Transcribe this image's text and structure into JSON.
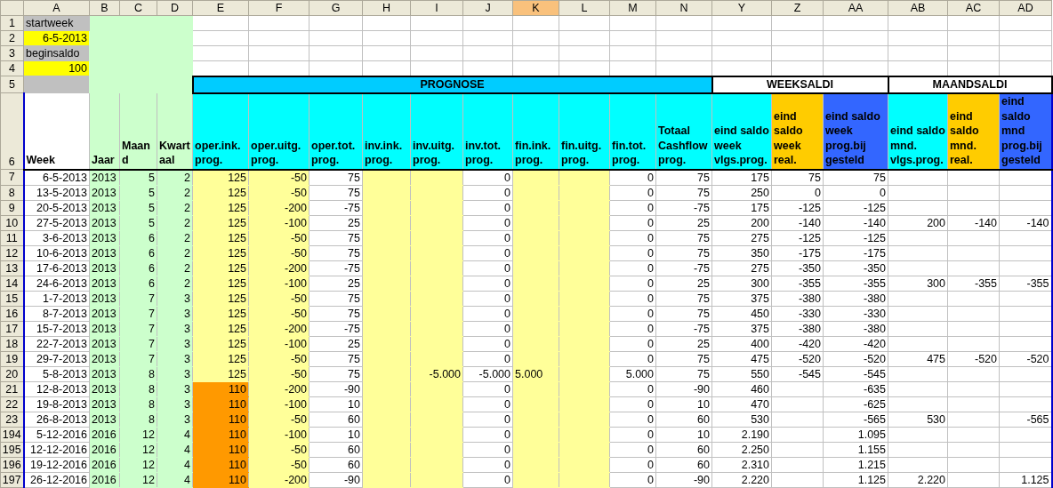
{
  "columns": [
    {
      "letter": "A",
      "selected": false,
      "color": "#ffffff"
    },
    {
      "letter": "B",
      "selected": false,
      "color": "#ccffcc"
    },
    {
      "letter": "C",
      "selected": false,
      "color": "#ccffcc"
    },
    {
      "letter": "D",
      "selected": false,
      "color": "#ccffcc"
    },
    {
      "letter": "E",
      "selected": false,
      "color": "#ffff99"
    },
    {
      "letter": "F",
      "selected": false,
      "color": "#ffff99"
    },
    {
      "letter": "G",
      "selected": false,
      "color": "#ffffff"
    },
    {
      "letter": "H",
      "selected": false,
      "color": "#ffff99"
    },
    {
      "letter": "I",
      "selected": false,
      "color": "#ffff99"
    },
    {
      "letter": "J",
      "selected": false,
      "color": "#ffffff"
    },
    {
      "letter": "K",
      "selected": true,
      "color": "#ffff99"
    },
    {
      "letter": "L",
      "selected": false,
      "color": "#ffff99"
    },
    {
      "letter": "M",
      "selected": false,
      "color": "#ffffff"
    },
    {
      "letter": "N",
      "selected": false,
      "color": "#ffffff"
    },
    {
      "letter": "Y",
      "selected": false,
      "color": "#ffffff"
    },
    {
      "letter": "Z",
      "selected": false,
      "color": "#ffffff"
    },
    {
      "letter": "AA",
      "selected": false,
      "color": "#ffffff"
    },
    {
      "letter": "AB",
      "selected": false,
      "color": "#ffffff"
    },
    {
      "letter": "AC",
      "selected": false,
      "color": "#ffffff"
    },
    {
      "letter": "AD",
      "selected": false,
      "color": "#ffffff"
    }
  ],
  "settings": [
    {
      "row": "1",
      "kind": "label",
      "text": "startweek"
    },
    {
      "row": "2",
      "kind": "value",
      "text": "6-5-2013"
    },
    {
      "row": "3",
      "kind": "label",
      "text": "beginsaldo"
    },
    {
      "row": "4",
      "kind": "value",
      "text": "100"
    }
  ],
  "section_row": "5",
  "sections": [
    {
      "title": "PROGNOSE",
      "color": "#00ccff"
    },
    {
      "title": "WEEKSALDI",
      "color": "#ffffff"
    },
    {
      "title": "MAANDSALDI",
      "color": "#ffffff"
    }
  ],
  "heading_row": "6",
  "headings": [
    {
      "text": "Week",
      "color": "#ffffff"
    },
    {
      "text": "Jaar",
      "color": "#ccffcc"
    },
    {
      "text": "Maand",
      "color": "#ccffcc"
    },
    {
      "text": "Kwartaal",
      "color": "#ccffcc"
    },
    {
      "text": "oper.ink. prog.",
      "color": "#00ffff"
    },
    {
      "text": "oper.uitg. prog.",
      "color": "#00ffff"
    },
    {
      "text": "oper.tot. prog.",
      "color": "#00ffff"
    },
    {
      "text": "inv.ink. prog.",
      "color": "#00ffff"
    },
    {
      "text": "inv.uitg. prog.",
      "color": "#00ffff"
    },
    {
      "text": "inv.tot. prog.",
      "color": "#00ffff"
    },
    {
      "text": "fin.ink. prog.",
      "color": "#00ffff"
    },
    {
      "text": "fin.uitg. prog.",
      "color": "#00ffff"
    },
    {
      "text": "fin.tot. prog.",
      "color": "#00ffff"
    },
    {
      "text": "Totaal Cashflow prog.",
      "color": "#00ffff"
    },
    {
      "text": "eind saldo week vlgs.prog.",
      "color": "#00ffff"
    },
    {
      "text": "eind saldo week real.",
      "color": "#ffcc00"
    },
    {
      "text": "eind saldo week prog.bij gesteld",
      "color": "#3366ff"
    },
    {
      "text": "eind saldo mnd. vlgs.prog.",
      "color": "#00ffff"
    },
    {
      "text": "eind saldo mnd. real.",
      "color": "#ffcc00"
    },
    {
      "text": "eind saldo mnd prog.bij gesteld",
      "color": "#3366ff"
    }
  ],
  "rows": [
    {
      "row": "7",
      "cells": [
        "6-5-2013",
        "2013",
        "5",
        "2",
        "125",
        "-50",
        "75",
        null,
        null,
        "0",
        null,
        null,
        "0",
        "75",
        "175",
        "75",
        "75",
        null,
        null,
        null
      ]
    },
    {
      "row": "8",
      "cells": [
        "13-5-2013",
        "2013",
        "5",
        "2",
        "125",
        "-50",
        "75",
        null,
        null,
        "0",
        null,
        null,
        "0",
        "75",
        "250",
        "0",
        "0",
        null,
        null,
        null
      ]
    },
    {
      "row": "9",
      "cells": [
        "20-5-2013",
        "2013",
        "5",
        "2",
        "125",
        "-200",
        "-75",
        null,
        null,
        "0",
        null,
        null,
        "0",
        "-75",
        "175",
        "-125",
        "-125",
        null,
        null,
        null
      ]
    },
    {
      "row": "10",
      "cells": [
        "27-5-2013",
        "2013",
        "5",
        "2",
        "125",
        "-100",
        "25",
        null,
        null,
        "0",
        null,
        null,
        "0",
        "25",
        "200",
        "-140",
        "-140",
        "200",
        "-140",
        "-140"
      ]
    },
    {
      "row": "11",
      "cells": [
        "3-6-2013",
        "2013",
        "6",
        "2",
        "125",
        "-50",
        "75",
        null,
        null,
        "0",
        null,
        null,
        "0",
        "75",
        "275",
        "-125",
        "-125",
        null,
        null,
        null
      ]
    },
    {
      "row": "12",
      "cells": [
        "10-6-2013",
        "2013",
        "6",
        "2",
        "125",
        "-50",
        "75",
        null,
        null,
        "0",
        null,
        null,
        "0",
        "75",
        "350",
        "-175",
        "-175",
        null,
        null,
        null
      ]
    },
    {
      "row": "13",
      "cells": [
        "17-6-2013",
        "2013",
        "6",
        "2",
        "125",
        "-200",
        "-75",
        null,
        null,
        "0",
        null,
        null,
        "0",
        "-75",
        "275",
        "-350",
        "-350",
        null,
        null,
        null
      ]
    },
    {
      "row": "14",
      "cells": [
        "24-6-2013",
        "2013",
        "6",
        "2",
        "125",
        "-100",
        "25",
        null,
        null,
        "0",
        null,
        null,
        "0",
        "25",
        "300",
        "-355",
        "-355",
        "300",
        "-355",
        "-355"
      ]
    },
    {
      "row": "15",
      "cells": [
        "1-7-2013",
        "2013",
        "7",
        "3",
        "125",
        "-50",
        "75",
        null,
        null,
        "0",
        null,
        null,
        "0",
        "75",
        "375",
        "-380",
        "-380",
        null,
        null,
        null
      ]
    },
    {
      "row": "16",
      "cells": [
        "8-7-2013",
        "2013",
        "7",
        "3",
        "125",
        "-50",
        "75",
        null,
        null,
        "0",
        null,
        null,
        "0",
        "75",
        "450",
        "-330",
        "-330",
        null,
        null,
        null
      ]
    },
    {
      "row": "17",
      "cells": [
        "15-7-2013",
        "2013",
        "7",
        "3",
        "125",
        "-200",
        "-75",
        null,
        null,
        "0",
        null,
        null,
        "0",
        "-75",
        "375",
        "-380",
        "-380",
        null,
        null,
        null
      ]
    },
    {
      "row": "18",
      "cells": [
        "22-7-2013",
        "2013",
        "7",
        "3",
        "125",
        "-100",
        "25",
        null,
        null,
        "0",
        null,
        null,
        "0",
        "25",
        "400",
        "-420",
        "-420",
        null,
        null,
        null
      ]
    },
    {
      "row": "19",
      "cells": [
        "29-7-2013",
        "2013",
        "7",
        "3",
        "125",
        "-50",
        "75",
        null,
        null,
        "0",
        null,
        null,
        "0",
        "75",
        "475",
        "-520",
        "-520",
        "475",
        "-520",
        "-520"
      ]
    },
    {
      "row": "20",
      "cells": [
        "5-8-2013",
        "2013",
        "8",
        "3",
        "125",
        "-50",
        "75",
        null,
        "-5.000",
        "-5.000",
        {
          "value": "5.000",
          "kind": "text"
        },
        null,
        "5.000",
        "75",
        "550",
        "-545",
        "-545",
        null,
        null,
        null
      ]
    },
    {
      "row": "21",
      "cells": [
        "12-8-2013",
        "2013",
        "8",
        "3",
        {
          "value": "110",
          "color": "#ff9900"
        },
        "-200",
        "-90",
        null,
        null,
        "0",
        null,
        null,
        "0",
        "-90",
        "460",
        null,
        "-635",
        null,
        null,
        null
      ]
    },
    {
      "row": "22",
      "cells": [
        "19-8-2013",
        "2013",
        "8",
        "3",
        {
          "value": "110",
          "color": "#ff9900"
        },
        "-100",
        "10",
        null,
        null,
        "0",
        null,
        null,
        "0",
        "10",
        "470",
        null,
        "-625",
        null,
        null,
        null
      ]
    },
    {
      "row": "23",
      "cells": [
        "26-8-2013",
        "2013",
        "8",
        "3",
        {
          "value": "110",
          "color": "#ff9900"
        },
        "-50",
        "60",
        null,
        null,
        "0",
        null,
        null,
        "0",
        "60",
        "530",
        null,
        "-565",
        "530",
        null,
        "-565"
      ]
    },
    {
      "row": "194",
      "cells": [
        "5-12-2016",
        "2016",
        "12",
        "4",
        {
          "value": "110",
          "color": "#ff9900"
        },
        "-100",
        "10",
        null,
        null,
        "0",
        null,
        null,
        "0",
        "10",
        "2.190",
        null,
        "1.095",
        null,
        null,
        null
      ]
    },
    {
      "row": "195",
      "cells": [
        "12-12-2016",
        "2016",
        "12",
        "4",
        {
          "value": "110",
          "color": "#ff9900"
        },
        "-50",
        "60",
        null,
        null,
        "0",
        null,
        null,
        "0",
        "60",
        "2.250",
        null,
        "1.155",
        null,
        null,
        null
      ]
    },
    {
      "row": "196",
      "cells": [
        "19-12-2016",
        "2016",
        "12",
        "4",
        {
          "value": "110",
          "color": "#ff9900"
        },
        "-50",
        "60",
        null,
        null,
        "0",
        null,
        null,
        "0",
        "60",
        "2.310",
        null,
        "1.215",
        null,
        null,
        null
      ]
    },
    {
      "row": "197",
      "cells": [
        "26-12-2016",
        "2016",
        "12",
        "4",
        {
          "value": "110",
          "color": "#ff9900"
        },
        "-200",
        "-90",
        null,
        null,
        "0",
        null,
        null,
        "0",
        "-90",
        "2.220",
        null,
        "1.125",
        "2.220",
        null,
        "1.125"
      ]
    }
  ]
}
